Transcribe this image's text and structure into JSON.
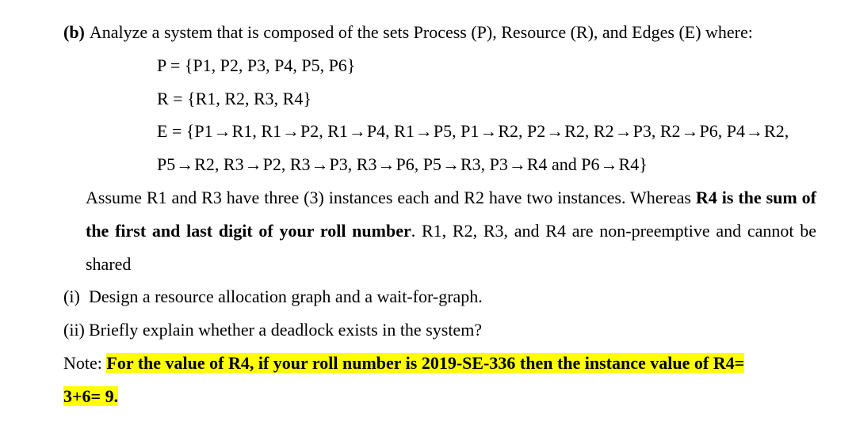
{
  "partLabel": "(b)",
  "prompt": "Analyze a system that is composed of the sets Process (P), Resource (R), and Edges (E) where:",
  "setP": "P = {P1, P2, P3, P4, P5, P6}",
  "setR": "R = {R1, R2, R3, R4}",
  "setE": {
    "prefix": "E = {",
    "edges": [
      "P1→R1",
      "R1→P2",
      "R1→P4",
      "R1→P5",
      "P1→R2",
      "P2→R2",
      "R2→P3",
      "R2→P6",
      "P4→R2",
      "P5→R2",
      "R3→P2",
      "R3→P3",
      "R3→P6",
      "P5→R3",
      "P3→R4"
    ],
    "lastConnector": " and ",
    "lastEdge": "P6→R4",
    "suffix": "}"
  },
  "assumeText1": "Assume R1 and R3 have three (3) instances each and R2 have two instances. Whereas ",
  "assumeBold": "R4 is the sum of the first and last digit of your roll number",
  "assumeText2": ". R1, R2, R3, and R4 are non-preemptive and cannot be shared",
  "sub_i_label": "(i)",
  "sub_i_text": "Design a resource allocation graph and a wait-for-graph.",
  "sub_ii_label": "(ii)",
  "sub_ii_text": "Briefly explain whether a deadlock exists in the system?",
  "noteLabel": "Note: ",
  "noteHighlight1": "For the value of R4, if your roll number is 2019-SE-336 then the instance value of R4=",
  "noteHighlight2": "3+6= 9."
}
